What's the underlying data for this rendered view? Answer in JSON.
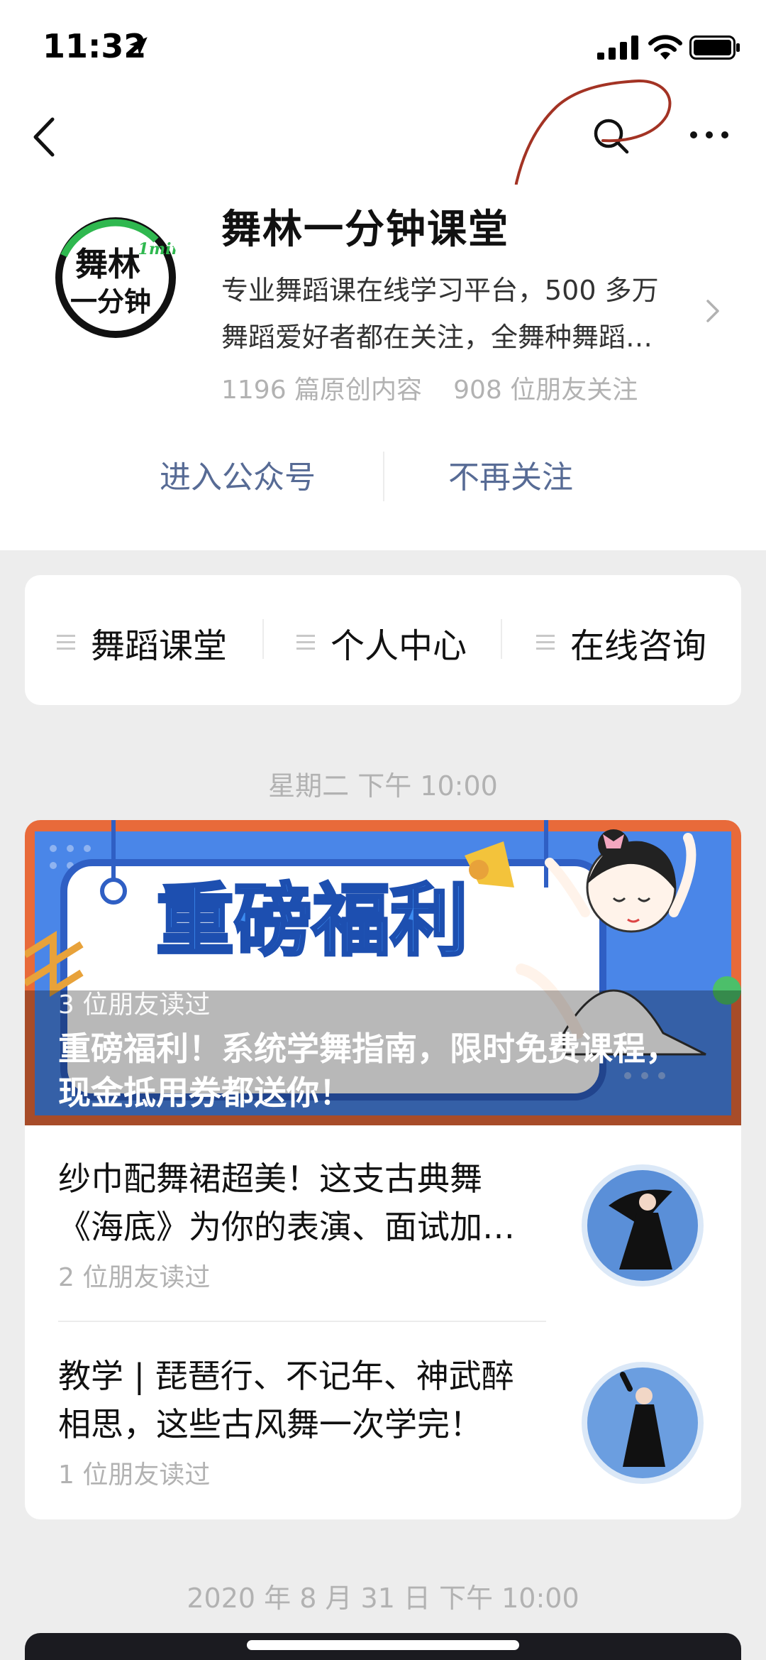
{
  "status_bar": {
    "time": "11:32",
    "icons": [
      "location-arrow-icon",
      "signal-icon",
      "wifi-icon",
      "battery-icon"
    ]
  },
  "nav": {
    "icons": [
      "back-icon",
      "search-icon",
      "more-icon"
    ]
  },
  "account": {
    "name": "舞林一分钟课堂",
    "logo_text_line1": "舞林",
    "logo_text_line2": "一分钟",
    "logo_badge": "1min",
    "description_line1": "专业舞蹈课在线学习平台，500 多万",
    "description_line2": "舞蹈爱好者都在关注，全舞种舞蹈…",
    "original_count": "1196 篇原创内容",
    "friends_following": "908 位朋友关注",
    "enter_label": "进入公众号",
    "unfollow_label": "不再关注"
  },
  "menu": {
    "items": [
      {
        "label": "舞蹈课堂"
      },
      {
        "label": "个人中心"
      },
      {
        "label": "在线咨询"
      }
    ]
  },
  "feed": {
    "timestamp1": "星期二 下午 10:00",
    "hero": {
      "banner_text": "重磅福利",
      "read_by": "3 位朋友读过",
      "title": "重磅福利！系统学舞指南，限时免费课程，现金抵用券都送你！"
    },
    "articles": [
      {
        "title_line1": "纱巾配舞裙超美！这支古典舞",
        "title_line2": "《海底》为你的表演、面试加…",
        "read_by": "2 位朋友读过"
      },
      {
        "title_line1": "教学 | 琵琶行、不记年、神武醉",
        "title_line2": "相思，这些古风舞一次学完！",
        "read_by": "1 位朋友读过"
      }
    ],
    "timestamp2": "2020 年 8 月 31 日 下午 10:00"
  },
  "colors": {
    "link": "#576b95",
    "muted": "#b2b2b2",
    "brand_green": "#2fb84f",
    "annotation_red": "#a33324",
    "banner_orange": "#e86a3a",
    "banner_blue": "#4a86e8"
  }
}
